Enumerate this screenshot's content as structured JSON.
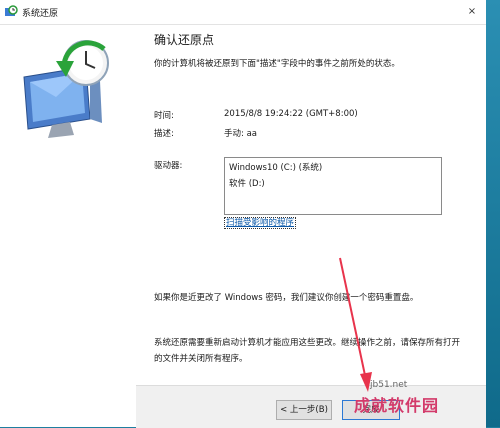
{
  "window": {
    "title": "系统还原",
    "close_glyph": "×"
  },
  "content": {
    "heading": "确认还原点",
    "description": "你的计算机将被还原到下面\"描述\"字段中的事件之前所处的状态。",
    "time_label": "时间:",
    "time_value": "2015/8/8 19:24:22 (GMT+8:00)",
    "desc_label": "描述:",
    "desc_value": "手动: aa",
    "drives_label": "驱动器:",
    "drives": [
      "Windows10 (C:) (系统)",
      "软件 (D:)"
    ],
    "scan_link": "扫描受影响的程序",
    "password_note": "如果你是近更改了 Windows 密码，我们建议你创建一个密码重置盘。",
    "restart_note": "系统还原需要重新启动计算机才能应用这些更改。继续操作之前，请保存所有打开的文件并关闭所有程序。"
  },
  "buttons": {
    "back": "< 上一步(B)",
    "finish": "完成"
  },
  "watermark": {
    "site": "jb51.net",
    "brand": "成就软件园"
  },
  "colors": {
    "link": "#0b58a8",
    "arrow": "#e8344c",
    "desktop": "#1e7fa0"
  }
}
